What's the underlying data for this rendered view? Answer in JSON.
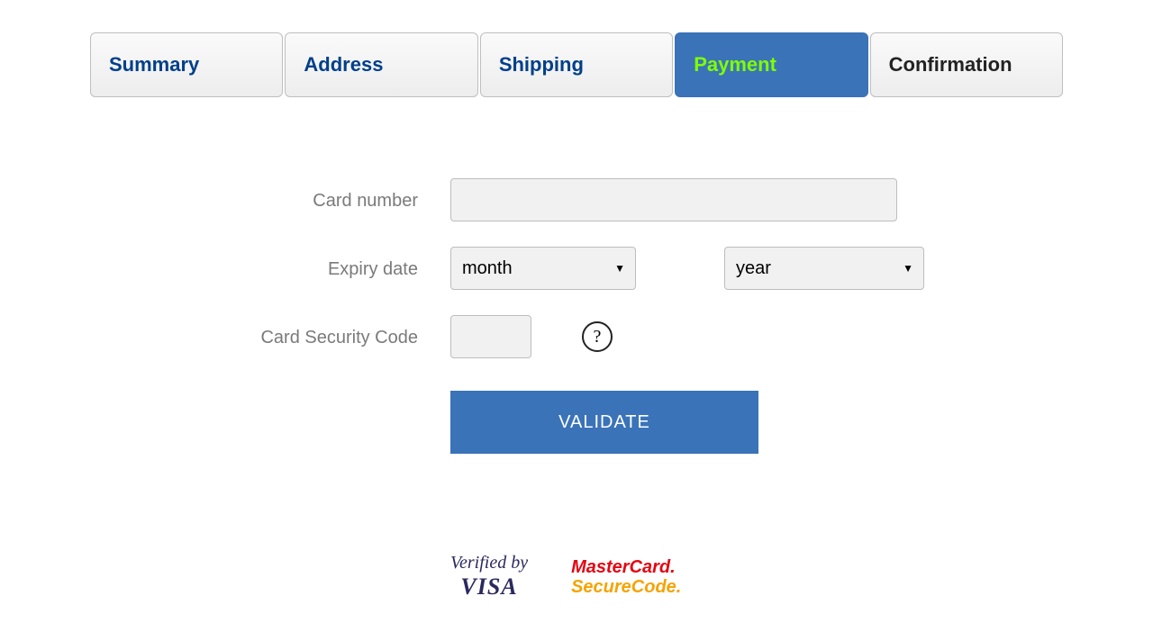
{
  "tabs": [
    {
      "label": "Summary",
      "kind": "link"
    },
    {
      "label": "Address",
      "kind": "link"
    },
    {
      "label": "Shipping",
      "kind": "link"
    },
    {
      "label": "Payment",
      "kind": "active"
    },
    {
      "label": "Confirmation",
      "kind": "plain"
    }
  ],
  "form": {
    "card_number_label": "Card number",
    "card_number_value": "",
    "expiry_label": "Expiry date",
    "month_selected": "month",
    "year_selected": "year",
    "csc_label": "Card Security Code",
    "csc_value": "",
    "help_char": "?",
    "submit_label": "VALIDATE"
  },
  "logos": {
    "vbv_line1": "Verified by",
    "vbv_line2": "VISA",
    "msc_line1": "MasterCard.",
    "msc_line2": "SecureCode."
  }
}
